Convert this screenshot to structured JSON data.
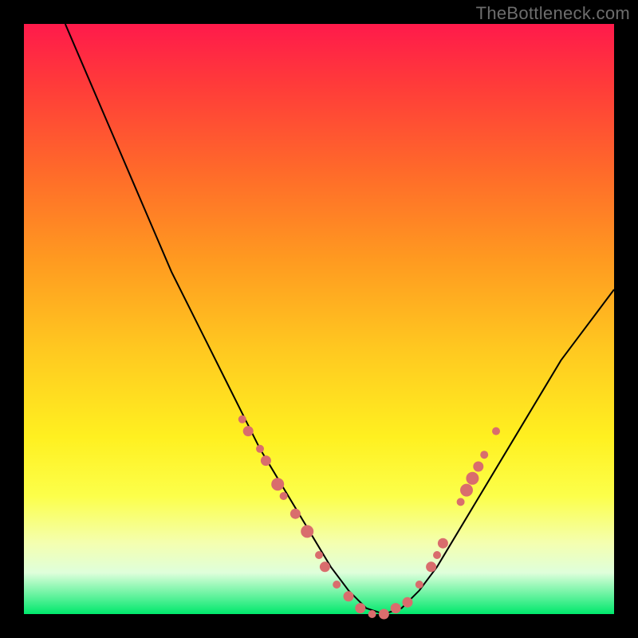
{
  "watermark": "TheBottleneck.com",
  "chart_data": {
    "type": "line",
    "title": "",
    "xlabel": "",
    "ylabel": "",
    "xlim": [
      0,
      100
    ],
    "ylim": [
      0,
      100
    ],
    "background": "heatmap-gradient",
    "background_stops": [
      {
        "pos": 0.0,
        "color": "#ff1a4b"
      },
      {
        "pos": 0.1,
        "color": "#ff3a3a"
      },
      {
        "pos": 0.25,
        "color": "#ff6a2a"
      },
      {
        "pos": 0.4,
        "color": "#ff9a20"
      },
      {
        "pos": 0.55,
        "color": "#ffc820"
      },
      {
        "pos": 0.7,
        "color": "#fff020"
      },
      {
        "pos": 0.8,
        "color": "#fcff4a"
      },
      {
        "pos": 0.88,
        "color": "#f4ffb0"
      },
      {
        "pos": 0.93,
        "color": "#dfffdb"
      },
      {
        "pos": 1.0,
        "color": "#00e86c"
      }
    ],
    "series": [
      {
        "name": "bottleneck-curve",
        "color": "#000000",
        "x": [
          7,
          10,
          13,
          16,
          19,
          22,
          25,
          28,
          31,
          34,
          37,
          40,
          43,
          46,
          49,
          52,
          55,
          58,
          61,
          64,
          67,
          70,
          73,
          76,
          79,
          82,
          85,
          88,
          91,
          94,
          97,
          100
        ],
        "y": [
          100,
          93,
          86,
          79,
          72,
          65,
          58,
          52,
          46,
          40,
          34,
          28,
          23,
          18,
          13,
          8,
          4,
          1,
          0,
          1,
          4,
          8,
          13,
          18,
          23,
          28,
          33,
          38,
          43,
          47,
          51,
          55
        ]
      }
    ],
    "markers": [
      {
        "name": "left-cluster",
        "x": 37,
        "y": 33,
        "r": 1.0,
        "color": "#d96d6d"
      },
      {
        "name": "left-cluster",
        "x": 38,
        "y": 31,
        "r": 1.3,
        "color": "#d96d6d"
      },
      {
        "name": "left-cluster",
        "x": 40,
        "y": 28,
        "r": 1.0,
        "color": "#d96d6d"
      },
      {
        "name": "left-cluster",
        "x": 41,
        "y": 26,
        "r": 1.3,
        "color": "#d96d6d"
      },
      {
        "name": "left-cluster",
        "x": 43,
        "y": 22,
        "r": 1.6,
        "color": "#d96d6d"
      },
      {
        "name": "left-cluster",
        "x": 44,
        "y": 20,
        "r": 1.0,
        "color": "#d96d6d"
      },
      {
        "name": "left-cluster",
        "x": 46,
        "y": 17,
        "r": 1.3,
        "color": "#d96d6d"
      },
      {
        "name": "left-cluster",
        "x": 48,
        "y": 14,
        "r": 1.6,
        "color": "#d96d6d"
      },
      {
        "name": "left-cluster",
        "x": 50,
        "y": 10,
        "r": 1.0,
        "color": "#d96d6d"
      },
      {
        "name": "left-cluster",
        "x": 51,
        "y": 8,
        "r": 1.3,
        "color": "#d96d6d"
      },
      {
        "name": "bottom",
        "x": 53,
        "y": 5,
        "r": 1.0,
        "color": "#d96d6d"
      },
      {
        "name": "bottom",
        "x": 55,
        "y": 3,
        "r": 1.3,
        "color": "#d96d6d"
      },
      {
        "name": "bottom",
        "x": 57,
        "y": 1,
        "r": 1.3,
        "color": "#d96d6d"
      },
      {
        "name": "bottom",
        "x": 59,
        "y": 0,
        "r": 1.0,
        "color": "#d96d6d"
      },
      {
        "name": "bottom",
        "x": 61,
        "y": 0,
        "r": 1.3,
        "color": "#d96d6d"
      },
      {
        "name": "bottom",
        "x": 63,
        "y": 1,
        "r": 1.3,
        "color": "#d96d6d"
      },
      {
        "name": "bottom",
        "x": 65,
        "y": 2,
        "r": 1.3,
        "color": "#d96d6d"
      },
      {
        "name": "right-cluster",
        "x": 67,
        "y": 5,
        "r": 1.0,
        "color": "#d96d6d"
      },
      {
        "name": "right-cluster",
        "x": 69,
        "y": 8,
        "r": 1.3,
        "color": "#d96d6d"
      },
      {
        "name": "right-cluster",
        "x": 70,
        "y": 10,
        "r": 1.0,
        "color": "#d96d6d"
      },
      {
        "name": "right-cluster",
        "x": 71,
        "y": 12,
        "r": 1.3,
        "color": "#d96d6d"
      },
      {
        "name": "right-cluster",
        "x": 74,
        "y": 19,
        "r": 1.0,
        "color": "#d96d6d"
      },
      {
        "name": "right-cluster",
        "x": 75,
        "y": 21,
        "r": 1.6,
        "color": "#d96d6d"
      },
      {
        "name": "right-cluster",
        "x": 76,
        "y": 23,
        "r": 1.6,
        "color": "#d96d6d"
      },
      {
        "name": "right-cluster",
        "x": 77,
        "y": 25,
        "r": 1.3,
        "color": "#d96d6d"
      },
      {
        "name": "right-cluster",
        "x": 78,
        "y": 27,
        "r": 1.0,
        "color": "#d96d6d"
      },
      {
        "name": "right-cluster",
        "x": 80,
        "y": 31,
        "r": 1.0,
        "color": "#d96d6d"
      }
    ]
  }
}
